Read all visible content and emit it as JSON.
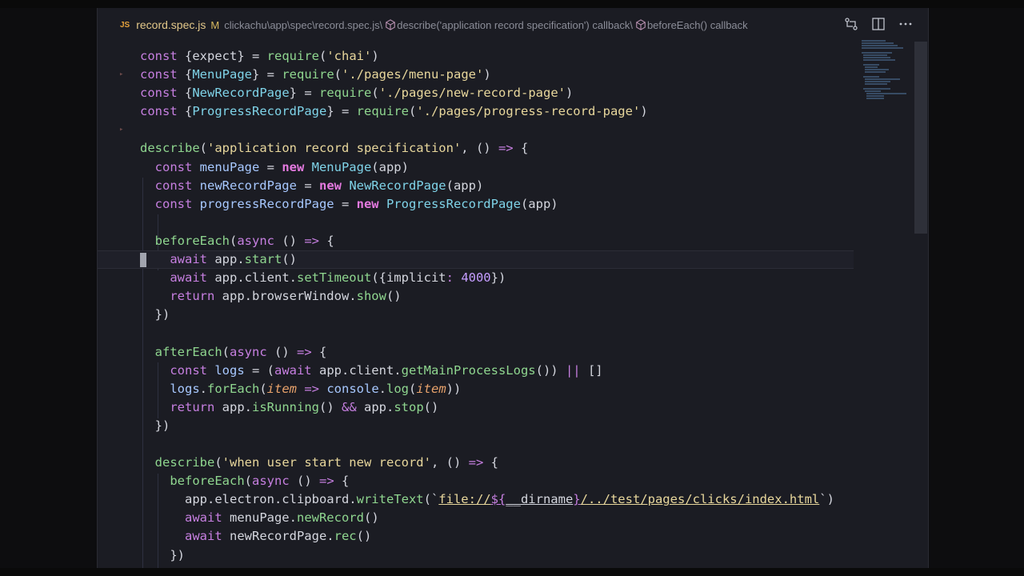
{
  "breadcrumb": {
    "file_badge": "JS",
    "file_name": "record.spec.js",
    "modified": "M",
    "path": "clickachu\\app\\spec\\record.spec.js\\",
    "crumb1": "describe('application record specification') callback\\",
    "crumb2": "beforeEach() callback"
  },
  "code": {
    "l1": {
      "a": "const ",
      "b": "{expect}",
      "c": " = ",
      "d": "require",
      "e": "(",
      "f": "'chai'",
      "g": ")"
    },
    "l2": {
      "a": "const ",
      "b": "{",
      "c": "MenuPage",
      "d": "}",
      "e": " = ",
      "f": "require",
      "g": "(",
      "h": "'./pages/menu-page'",
      "i": ")"
    },
    "l3": {
      "a": "const ",
      "b": "{",
      "c": "NewRecordPage",
      "d": "}",
      "e": " = ",
      "f": "require",
      "g": "(",
      "h": "'./pages/new-record-page'",
      "i": ")"
    },
    "l4": {
      "a": "const ",
      "b": "{",
      "c": "ProgressRecordPage",
      "d": "}",
      "e": " = ",
      "f": "require",
      "g": "(",
      "h": "'./pages/progress-record-page'",
      "i": ")"
    },
    "l6": {
      "a": "describe",
      "b": "(",
      "c": "'application record specification'",
      "d": ", () ",
      "e": "=>",
      "f": " {"
    },
    "l7": {
      "a": "  const ",
      "b": "menuPage",
      "c": " = ",
      "d": "new ",
      "e": "MenuPage",
      "f": "(app)"
    },
    "l8": {
      "a": "  const ",
      "b": "newRecordPage",
      "c": " = ",
      "d": "new ",
      "e": "NewRecordPage",
      "f": "(app)"
    },
    "l9": {
      "a": "  const ",
      "b": "progressRecordPage",
      "c": " = ",
      "d": "new ",
      "e": "ProgressRecordPage",
      "f": "(app)"
    },
    "l11": {
      "a": "  beforeEach",
      "b": "(",
      "c": "async",
      "d": " () ",
      "e": "=>",
      "f": " {"
    },
    "l12": {
      "a": "    await",
      "b": " app.",
      "c": "start",
      "d": "()"
    },
    "l13": {
      "a": "    await",
      "b": " app.client.",
      "c": "setTimeout",
      "d": "({implicit",
      "e": ": ",
      "f": "4000",
      "g": "})"
    },
    "l14": {
      "a": "    return",
      "b": " app.browserWindow.",
      "c": "show",
      "d": "()"
    },
    "l15": {
      "a": "  })"
    },
    "l17": {
      "a": "  afterEach",
      "b": "(",
      "c": "async",
      "d": " () ",
      "e": "=>",
      "f": " {"
    },
    "l18": {
      "a": "    const ",
      "b": "logs",
      "c": " = (",
      "d": "await",
      "e": " app.client.",
      "f": "getMainProcessLogs",
      "g": "()) ",
      "h": "||",
      "i": " []"
    },
    "l19": {
      "a": "    logs",
      "b": ".",
      "c": "forEach",
      "d": "(",
      "e": "item",
      "f": " => ",
      "g": "console",
      "h": ".",
      "i": "log",
      "j": "(",
      "k": "item",
      "l": "))"
    },
    "l20": {
      "a": "    return",
      "b": " app.",
      "c": "isRunning",
      "d": "() ",
      "e": "&&",
      "f": " app.",
      "g": "stop",
      "h": "()"
    },
    "l21": {
      "a": "  })"
    },
    "l23": {
      "a": "  describe",
      "b": "(",
      "c": "'when user start new record'",
      "d": ", () ",
      "e": "=>",
      "f": " {"
    },
    "l24": {
      "a": "    beforeEach",
      "b": "(",
      "c": "async",
      "d": " () ",
      "e": "=>",
      "f": " {"
    },
    "l25": {
      "a": "      app.electron.clipboard.",
      "b": "writeText",
      "c": "(`",
      "d": "file://",
      "e": "${",
      "f": "__dirname",
      "g": "}",
      "h": "/../test/pages/clicks/index.html",
      "i": "`)"
    },
    "l26": {
      "a": "      await",
      "b": " menuPage.",
      "c": "newRecord",
      "d": "()"
    },
    "l27": {
      "a": "      await",
      "b": " newRecordPage.",
      "c": "rec",
      "d": "()"
    },
    "l28": {
      "a": "    })"
    }
  },
  "icons": {
    "compare": "compare-changes-icon",
    "split": "split-editor-icon",
    "more": "more-actions-icon",
    "symbol": "symbol-method-icon"
  },
  "colors": {
    "keyword": "#c67fe0",
    "string": "#e8d79c",
    "function": "#8fd68f",
    "class": "#7fd3e8",
    "number": "#c59dff"
  }
}
